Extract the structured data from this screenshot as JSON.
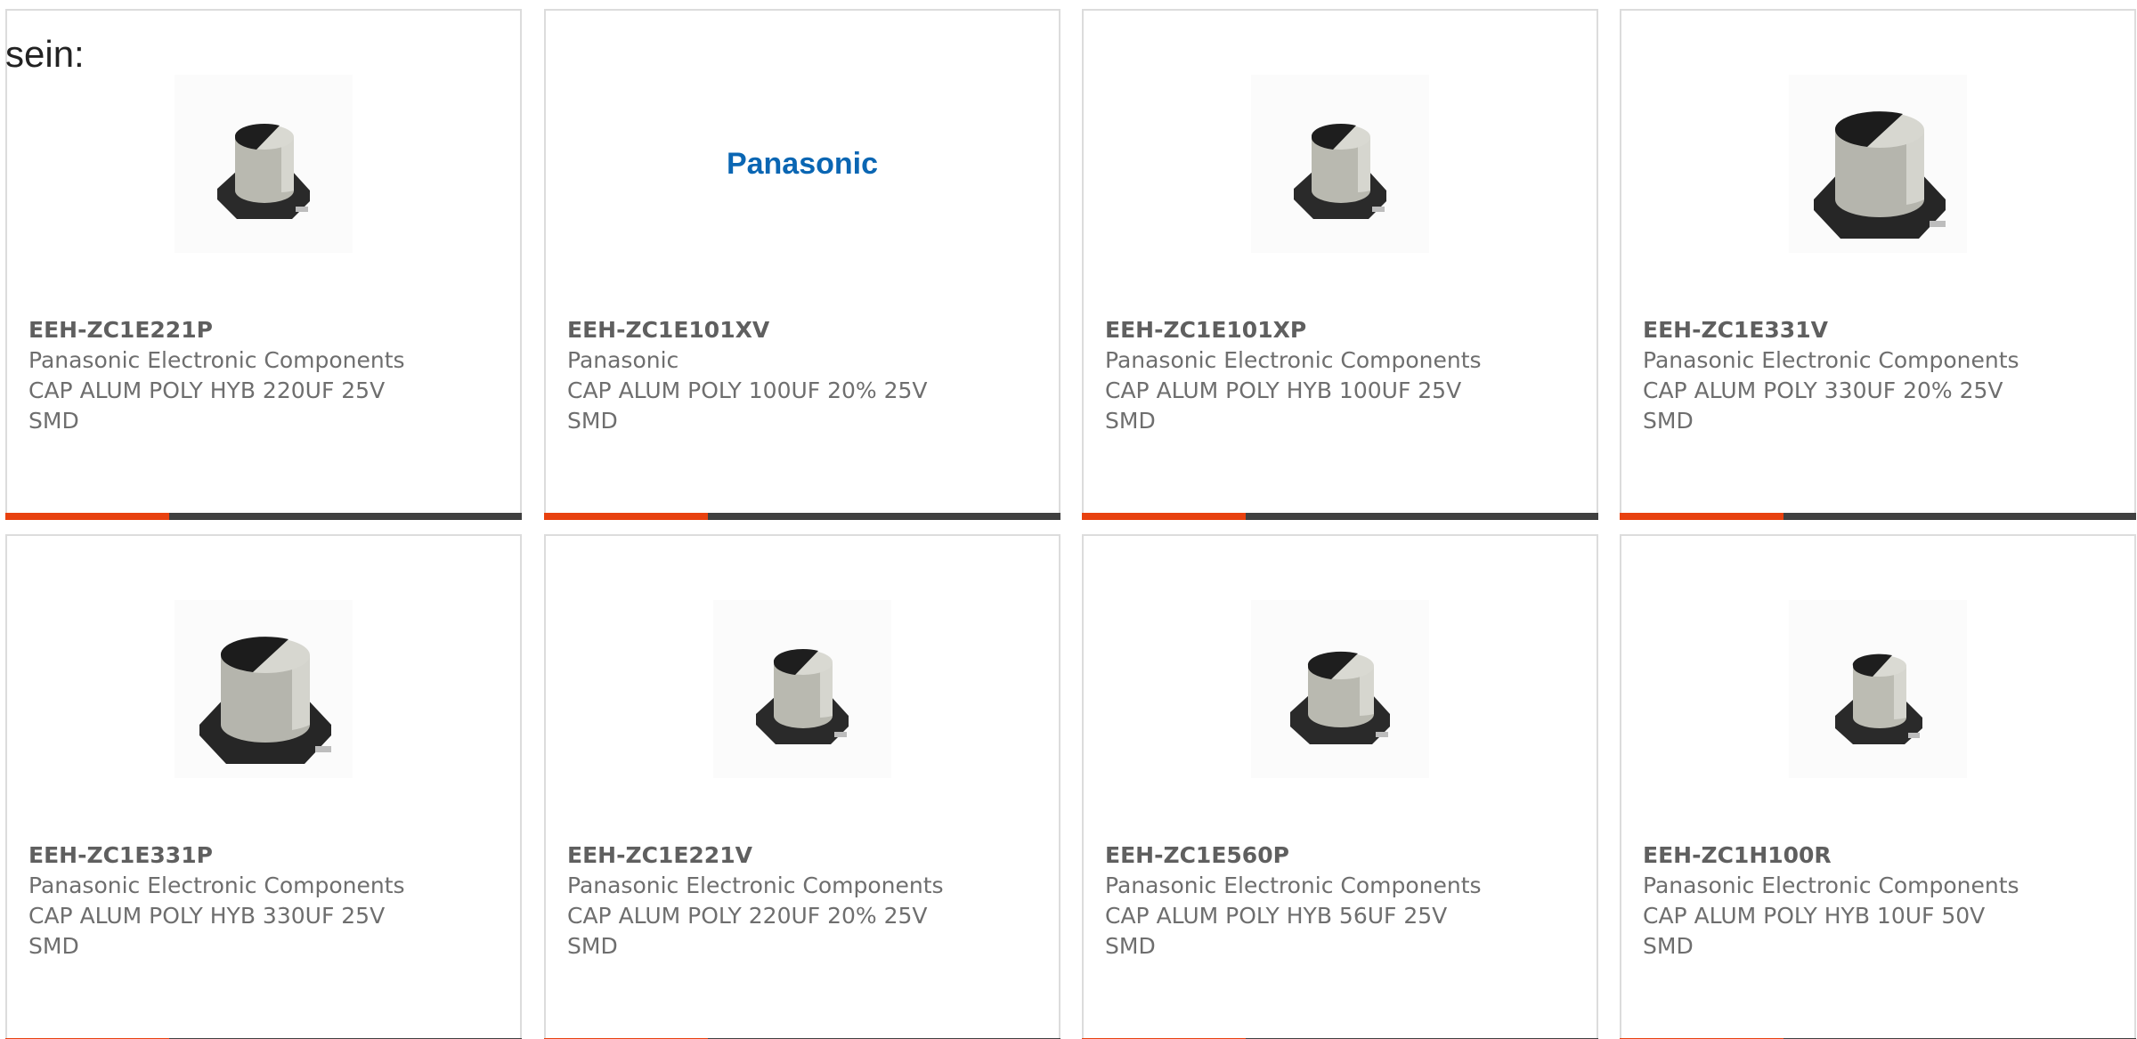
{
  "intro_text": "sein:",
  "colors": {
    "accent": "#e8410f",
    "bar_dark": "#404040",
    "logo_blue": "#0a66b3"
  },
  "products": [
    {
      "part_number": "EEH-ZC1E221P",
      "manufacturer": "Panasonic Electronic Components",
      "description_line1": "CAP ALUM POLY HYB 220UF 25V",
      "description_line2": "SMD",
      "image": "capacitor-small"
    },
    {
      "part_number": "EEH-ZC1E101XV",
      "manufacturer": "Panasonic",
      "description_line1": "CAP ALUM POLY 100UF 20% 25V",
      "description_line2": "SMD",
      "image": "panasonic-logo",
      "logo_text": "Panasonic"
    },
    {
      "part_number": "EEH-ZC1E101XP",
      "manufacturer": "Panasonic Electronic Components",
      "description_line1": "CAP ALUM POLY HYB 100UF 25V",
      "description_line2": "SMD",
      "image": "capacitor-small"
    },
    {
      "part_number": "EEH-ZC1E331V",
      "manufacturer": "Panasonic Electronic Components",
      "description_line1": "CAP ALUM POLY 330UF 20% 25V",
      "description_line2": "SMD",
      "image": "capacitor-large"
    },
    {
      "part_number": "EEH-ZC1E331P",
      "manufacturer": "Panasonic Electronic Components",
      "description_line1": "CAP ALUM POLY HYB 330UF 25V",
      "description_line2": "SMD",
      "image": "capacitor-large"
    },
    {
      "part_number": "EEH-ZC1E221V",
      "manufacturer": "Panasonic Electronic Components",
      "description_line1": "CAP ALUM POLY 220UF 20% 25V",
      "description_line2": "SMD",
      "image": "capacitor-small"
    },
    {
      "part_number": "EEH-ZC1E560P",
      "manufacturer": "Panasonic Electronic Components",
      "description_line1": "CAP ALUM POLY HYB 56UF 25V",
      "description_line2": "SMD",
      "image": "capacitor-small"
    },
    {
      "part_number": "EEH-ZC1H100R",
      "manufacturer": "Panasonic Electronic Components",
      "description_line1": "CAP ALUM POLY HYB 10UF 50V",
      "description_line2": "SMD",
      "image": "capacitor-small"
    }
  ]
}
